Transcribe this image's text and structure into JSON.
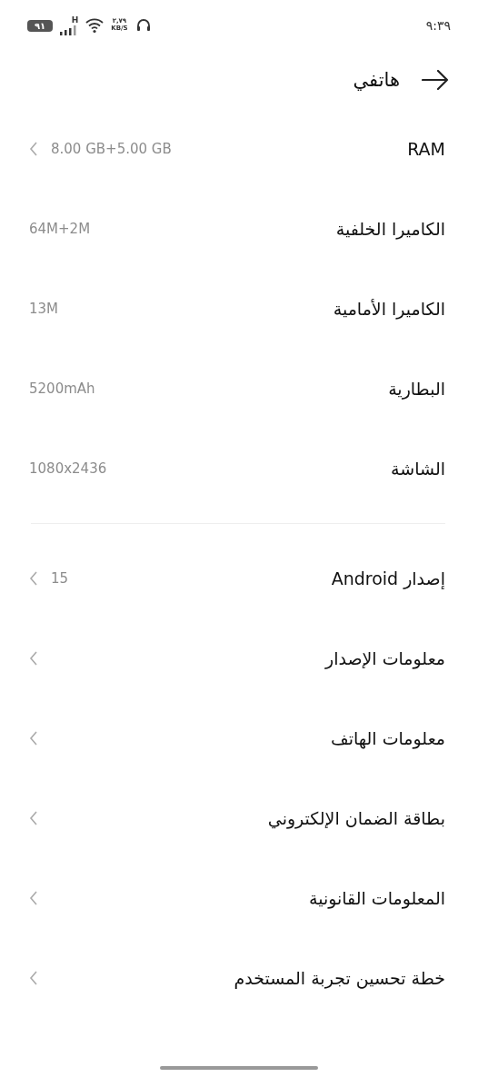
{
  "status_bar": {
    "time": "٩:٣٩",
    "battery": "٩١",
    "network": "H",
    "speed": "٢,٧٩",
    "speed_unit": "KB/S"
  },
  "header": {
    "title": "هاتفي"
  },
  "sections": [
    {
      "items": [
        {
          "label": "RAM",
          "value": "8.00 GB+5.00 GB",
          "chevron": true
        },
        {
          "label": "الكاميرا الخلفية",
          "value": "64M+2M",
          "chevron": false
        },
        {
          "label": "الكاميرا الأمامية",
          "value": "13M",
          "chevron": false
        },
        {
          "label": "البطارية",
          "value": "5200mAh",
          "chevron": false
        },
        {
          "label": "الشاشة",
          "value": "1080x2436",
          "chevron": false
        }
      ]
    },
    {
      "items": [
        {
          "label": "إصدار Android",
          "value": "15",
          "chevron": true
        },
        {
          "label": "معلومات الإصدار",
          "chevron": true
        },
        {
          "label": "معلومات الهاتف",
          "chevron": true
        },
        {
          "label": "بطاقة الضمان الإلكتروني",
          "chevron": true
        },
        {
          "label": "المعلومات القانونية",
          "chevron": true
        },
        {
          "label": "خطة تحسين تجربة المستخدم",
          "chevron": true
        }
      ]
    }
  ]
}
